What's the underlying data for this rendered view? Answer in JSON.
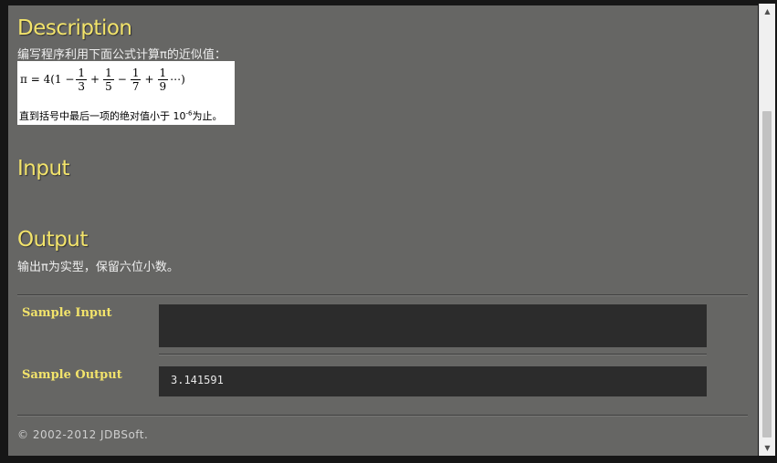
{
  "description": {
    "title": "Description",
    "text": "编写程序利用下面公式计算π的近似值：",
    "formula": {
      "lhs": "π = 4",
      "open": "(1 −",
      "terms": [
        {
          "num": "1",
          "den": "3",
          "op_before": ""
        },
        {
          "num": "1",
          "den": "5",
          "op_before": "+"
        },
        {
          "num": "1",
          "den": "7",
          "op_before": "−"
        },
        {
          "num": "1",
          "den": "9",
          "op_before": "+"
        }
      ],
      "close": "⋯)",
      "note_prefix": "直到括号中最后一项的绝对值小于 10",
      "note_exp": "-6",
      "note_suffix": "为止。"
    }
  },
  "input": {
    "title": "Input",
    "text": ""
  },
  "output": {
    "title": "Output",
    "text": "输出π为实型，保留六位小数。"
  },
  "samples": {
    "input_label": "Sample Input",
    "input_value": "",
    "output_label": "Sample Output",
    "output_value": "3.141591"
  },
  "footer": {
    "text": "© 2002-2012  JDBSoft."
  },
  "colors": {
    "background": "#666664",
    "heading": "#f2e36b",
    "sample_box": "#2c2c2c"
  },
  "icons": {
    "scroll_up": "triangle-up",
    "scroll_down": "triangle-down"
  }
}
